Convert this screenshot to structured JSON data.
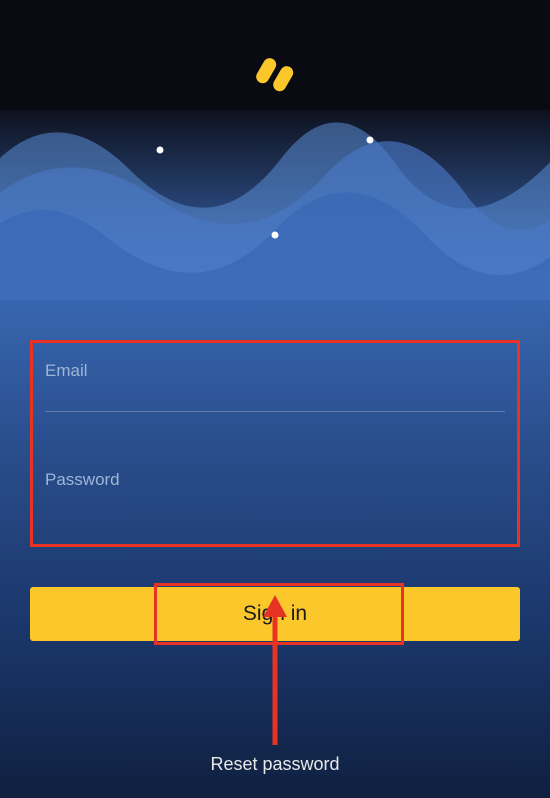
{
  "logo": {
    "name": "app-logo-icon"
  },
  "form": {
    "email": {
      "label": "Email",
      "value": ""
    },
    "password": {
      "label": "Password",
      "value": ""
    }
  },
  "signin": {
    "label": "Sign in"
  },
  "reset": {
    "label": "Reset password"
  },
  "colors": {
    "accent": "#fbc72a",
    "highlight": "#e63324",
    "bgtop": "#0a0a12"
  }
}
